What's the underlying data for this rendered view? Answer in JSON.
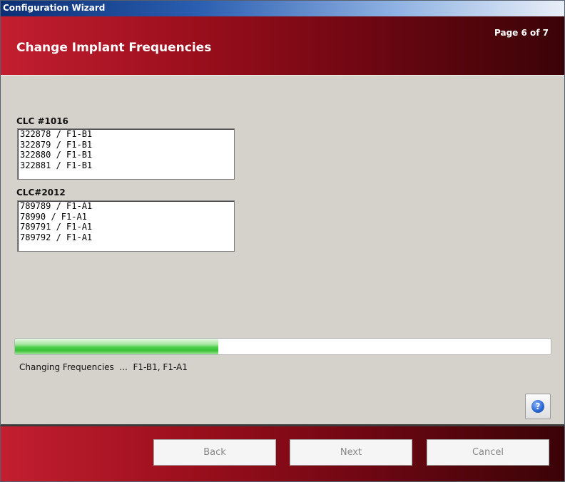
{
  "window": {
    "title": "Configuration Wizard"
  },
  "header": {
    "heading": "Change Implant Frequencies",
    "page": "Page 6 of 7"
  },
  "groups": [
    {
      "label": "CLC #1016",
      "items": [
        "322878 / F1-B1",
        "322879 / F1-B1",
        "322880 / F1-B1",
        "322881 / F1-B1"
      ]
    },
    {
      "label": "CLC#2012",
      "items": [
        "789789 / F1-A1",
        "78990 / F1-A1",
        "789791 / F1-A1",
        "789792 / F1-A1"
      ]
    }
  ],
  "progress": {
    "value_percent": 38,
    "color": "#3fc43a"
  },
  "status": {
    "text": "Changing Frequencies  ...  F1-B1, F1-A1"
  },
  "help": {
    "icon": "help-icon",
    "glyph": "?"
  },
  "footer": {
    "back_label": "Back",
    "next_label": "Next",
    "cancel_label": "Cancel"
  }
}
